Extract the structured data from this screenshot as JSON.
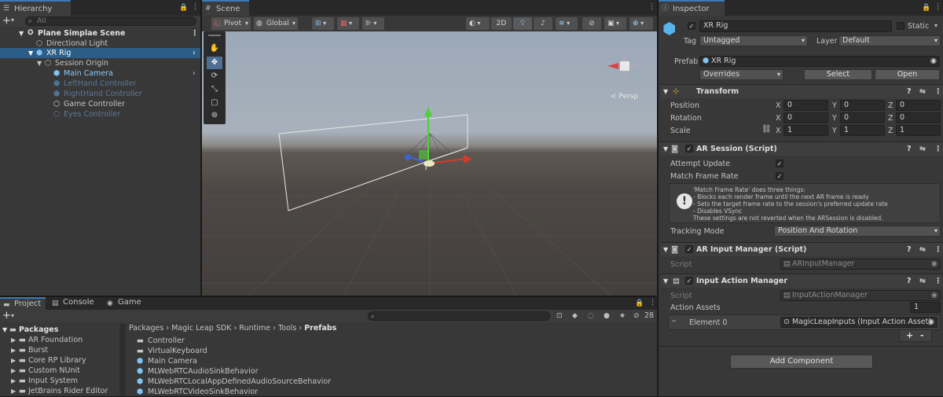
{
  "colors": {
    "accent": "#3a79bb",
    "selection": "#2c5d87",
    "disabled_text": "#5d7796",
    "panel": "#383838",
    "scene_sky": "#9aa7b6",
    "scene_ground": "#4a4542"
  },
  "hierarchy": {
    "tab": "Hierarchy",
    "add": "+",
    "search_placeholder": "All",
    "scene_name": "Plane Simplae Scene",
    "items": [
      {
        "label": "Directional Light"
      },
      {
        "label": "XR Rig"
      },
      {
        "label": "Session Origin"
      },
      {
        "label": "Main Camera"
      },
      {
        "label": "LeftHand Controller"
      },
      {
        "label": "RightHand Controller"
      },
      {
        "label": "Game Controller"
      },
      {
        "label": "Eyes Controller"
      }
    ]
  },
  "scene": {
    "tab": "Scene",
    "pivot": "Pivot",
    "global": "Global",
    "mode_2d": "2D",
    "gizmo_label": "< Persp"
  },
  "inspector": {
    "tab": "Inspector",
    "object_name": "XR Rig",
    "static_label": "Static",
    "tag_label": "Tag",
    "tag_value": "Untagged",
    "layer_label": "Layer",
    "layer_value": "Default",
    "prefab_label": "Prefab",
    "prefab_value": "XR Rig",
    "overrides": "Overrides",
    "select": "Select",
    "open": "Open",
    "transform": {
      "title": "Transform",
      "position_label": "Position",
      "rotation_label": "Rotation",
      "scale_label": "Scale",
      "axis_x": "X",
      "axis_y": "Y",
      "axis_z": "Z",
      "position": {
        "x": "0",
        "y": "0",
        "z": "0"
      },
      "rotation": {
        "x": "0",
        "y": "0",
        "z": "0"
      },
      "scale": {
        "x": "1",
        "y": "1",
        "z": "1"
      }
    },
    "ar_session": {
      "title": "AR Session (Script)",
      "attempt_update": "Attempt Update",
      "match_frame_rate": "Match Frame Rate",
      "help_1": "'Match Frame Rate' does three things:",
      "help_2": " - Blocks each render frame until the next AR frame is ready",
      "help_3": " - Sets the target frame rate to the session's preferred update rate",
      "help_4": " - Disables VSync",
      "help_5": "These settings are not reverted when the ARSession is disabled.",
      "tracking_mode_label": "Tracking Mode",
      "tracking_mode_value": "Position And Rotation"
    },
    "ar_input_manager": {
      "title": "AR Input Manager (Script)",
      "script_label": "Script",
      "script_value": "ARInputManager"
    },
    "input_action_manager": {
      "title": "Input Action Manager",
      "script_label": "Script",
      "script_value": "InputActionManager",
      "action_assets_label": "Action Assets",
      "action_assets_count": "1",
      "element_label": "Element 0",
      "element_value": "MagicLeapInputs (Input Action Asset)",
      "plus": "+",
      "minus": "-"
    },
    "add_component": "Add Component"
  },
  "project": {
    "tabs": [
      "Project",
      "Console",
      "Game"
    ],
    "add": "+",
    "count": "28",
    "breadcrumb": [
      "Packages",
      "Magic Leap SDK",
      "Runtime",
      "Tools",
      "Prefabs"
    ],
    "tree_root": "Packages",
    "tree": [
      "AR Foundation",
      "Burst",
      "Core RP Library",
      "Custom NUnit",
      "Input System",
      "JetBrains Rider Editor"
    ],
    "files": [
      {
        "label": "Controller",
        "icon": "folder-icon"
      },
      {
        "label": "VirtualKeyboard",
        "icon": "folder-icon"
      },
      {
        "label": "Main Camera",
        "icon": "prefab-icon"
      },
      {
        "label": "MLWebRTCAudioSinkBehavior",
        "icon": "prefab-icon"
      },
      {
        "label": "MLWebRTCLocalAppDefinedAudioSourceBehavior",
        "icon": "prefab-icon"
      },
      {
        "label": "MLWebRTCVideoSinkBehavior",
        "icon": "prefab-icon"
      }
    ]
  }
}
